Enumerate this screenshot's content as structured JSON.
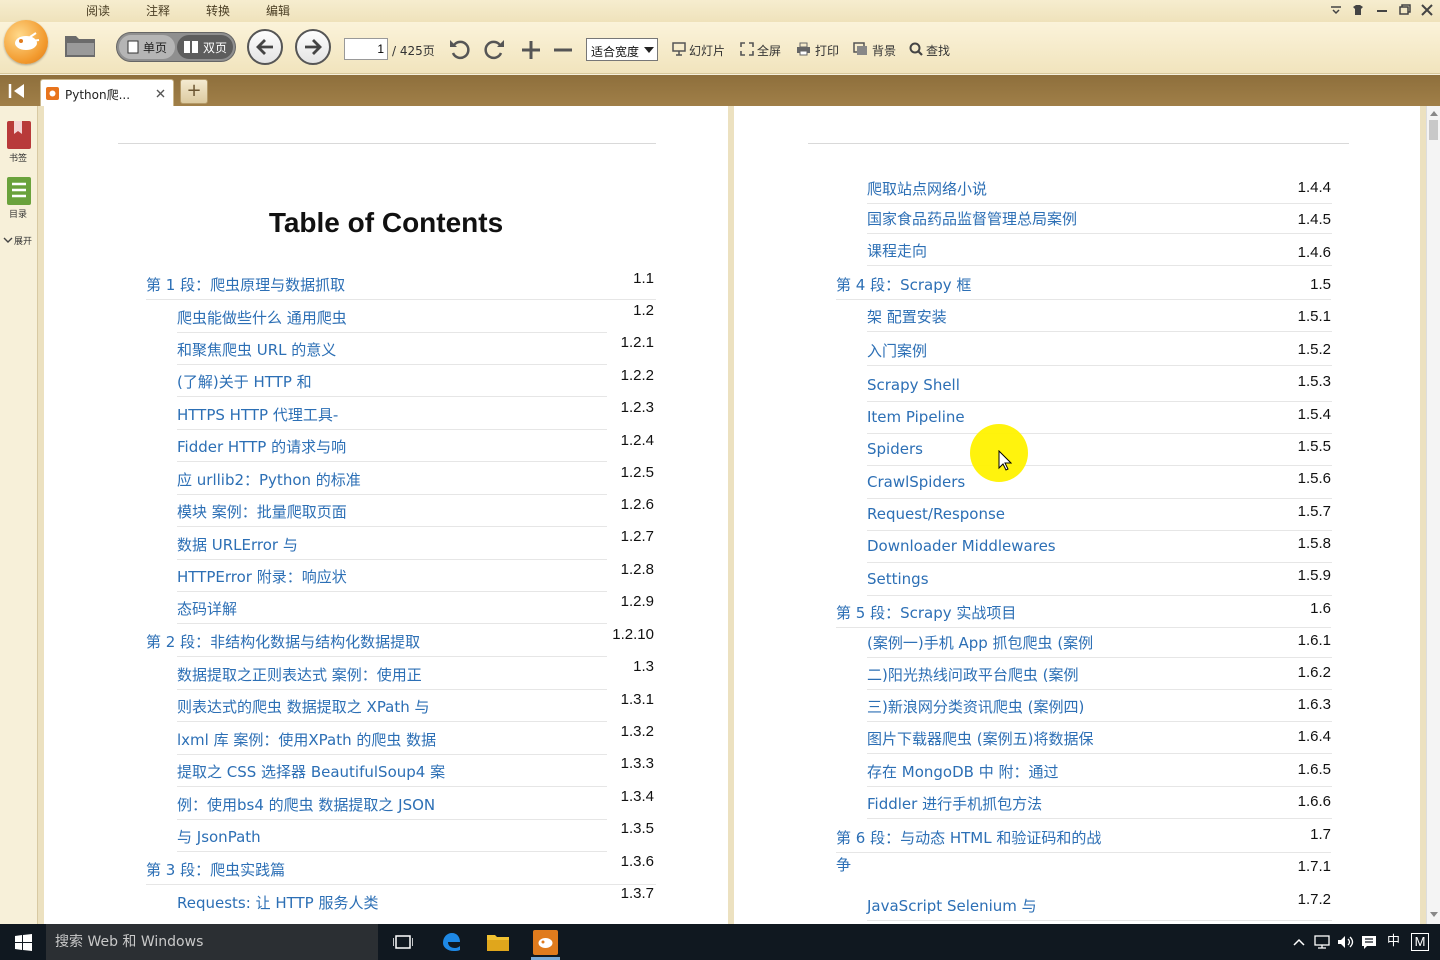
{
  "menu": {
    "tabs": [
      "阅读",
      "注释",
      "转换",
      "编辑"
    ]
  },
  "toolbar": {
    "single_page": "单页",
    "double_page": "双页",
    "page_input": "1",
    "page_total": "/ 425页",
    "zoom_select": "适合宽度",
    "slideshow": "幻灯片",
    "fullscreen": "全屏",
    "print": "打印",
    "background": "背景",
    "find": "查找"
  },
  "tabs": {
    "doc_title": "Python爬...",
    "add": "+"
  },
  "sidebar": {
    "bookmarks": "书签",
    "toc": "目录",
    "expand": "展开"
  },
  "left_page": {
    "title": "Table of Contents",
    "entries": [
      {
        "text": "第 1 段：爬虫原理与数据抓取",
        "num": "1.1"
      },
      {
        "text": "爬虫能做些什么 通用爬虫",
        "num": "1.2"
      },
      {
        "text": "和聚焦爬虫 URL 的意义",
        "num": "1.2.1"
      },
      {
        "text": "(了解)关于 HTTP 和",
        "num": "1.2.2"
      },
      {
        "text": "HTTPS HTTP 代理工具-",
        "num": "1.2.3"
      },
      {
        "text": "Fidder HTTP 的请求与响",
        "num": "1.2.4"
      },
      {
        "text": "应 urllib2：Python 的标准",
        "num": "1.2.5"
      },
      {
        "text": "模块 案例：批量爬取页面",
        "num": "1.2.6"
      },
      {
        "text": "数据 URLError 与",
        "num": "1.2.7"
      },
      {
        "text": "HTTPError 附录：响应状",
        "num": "1.2.8"
      },
      {
        "text": "态码详解",
        "num": "1.2.9"
      },
      {
        "text": "第 2 段：非结构化数据与结构化数据提取",
        "num": "1.2.10"
      },
      {
        "text": "数据提取之正则表达式 案例：使用正",
        "num": "1.3"
      },
      {
        "text": "则表达式的爬虫 数据提取之 XPath 与",
        "num": "1.3.1"
      },
      {
        "text": "lxml 库 案例：使用XPath 的爬虫 数据",
        "num": "1.3.2"
      },
      {
        "text": "提取之 CSS 选择器 BeautifulSoup4 案",
        "num": "1.3.3"
      },
      {
        "text": "例：使用bs4 的爬虫 数据提取之 JSON",
        "num": "1.3.4"
      },
      {
        "text": "与 JsonPath",
        "num": "1.3.5"
      },
      {
        "text": "第 3 段：爬虫实践篇",
        "num": "1.3.6"
      },
      {
        "text": "Requests: 让 HTTP 服务人类",
        "num": "1.3.7"
      }
    ]
  },
  "right_page": {
    "entries": [
      {
        "text": "爬取站点网络小说",
        "num": "1.4.4"
      },
      {
        "text": "国家食品药品监督管理总局案例",
        "num": "1.4.5"
      },
      {
        "text": "课程走向",
        "num": "1.4.6"
      },
      {
        "text": "第 4 段：Scrapy 框",
        "num": "1.5"
      },
      {
        "text": "架 配置安装",
        "num": "1.5.1"
      },
      {
        "text": "入门案例",
        "num": "1.5.2"
      },
      {
        "text": "Scrapy Shell",
        "num": "1.5.3"
      },
      {
        "text": "Item Pipeline",
        "num": "1.5.4"
      },
      {
        "text": "Spiders",
        "num": "1.5.5"
      },
      {
        "text": "CrawlSpiders",
        "num": "1.5.6"
      },
      {
        "text": "Request/Response",
        "num": "1.5.7"
      },
      {
        "text": "Downloader Middlewares",
        "num": "1.5.8"
      },
      {
        "text": "Settings",
        "num": "1.5.9"
      },
      {
        "text": "第 5 段：Scrapy 实战项目",
        "num": "1.6"
      },
      {
        "text": "(案例一)手机 App 抓包爬虫 (案例",
        "num": "1.6.1"
      },
      {
        "text": "二)阳光热线问政平台爬虫 (案例",
        "num": "1.6.2"
      },
      {
        "text": "三)新浪网分类资讯爬虫 (案例四)",
        "num": "1.6.3"
      },
      {
        "text": "图片下载器爬虫 (案例五)将数据保",
        "num": "1.6.4"
      },
      {
        "text": "存在 MongoDB 中 附：通过",
        "num": "1.6.5"
      },
      {
        "text": "Fiddler 进行手机抓包方法",
        "num": "1.6.6"
      },
      {
        "text": "第 6 段：与动态 HTML 和验证码和的战",
        "num": "1.7"
      },
      {
        "text": "争",
        "num": "1.7.1"
      },
      {
        "text": "JavaScript Selenium 与",
        "num": "1.7.2"
      }
    ]
  },
  "taskbar": {
    "search_placeholder": "搜索 Web 和 Windows",
    "ime": "中",
    "ime_mode": "M"
  },
  "colors": {
    "accent": "#2c6fb5",
    "toolbar_bg": "#f1e4bd",
    "tabbar_bg": "#a07f48"
  }
}
